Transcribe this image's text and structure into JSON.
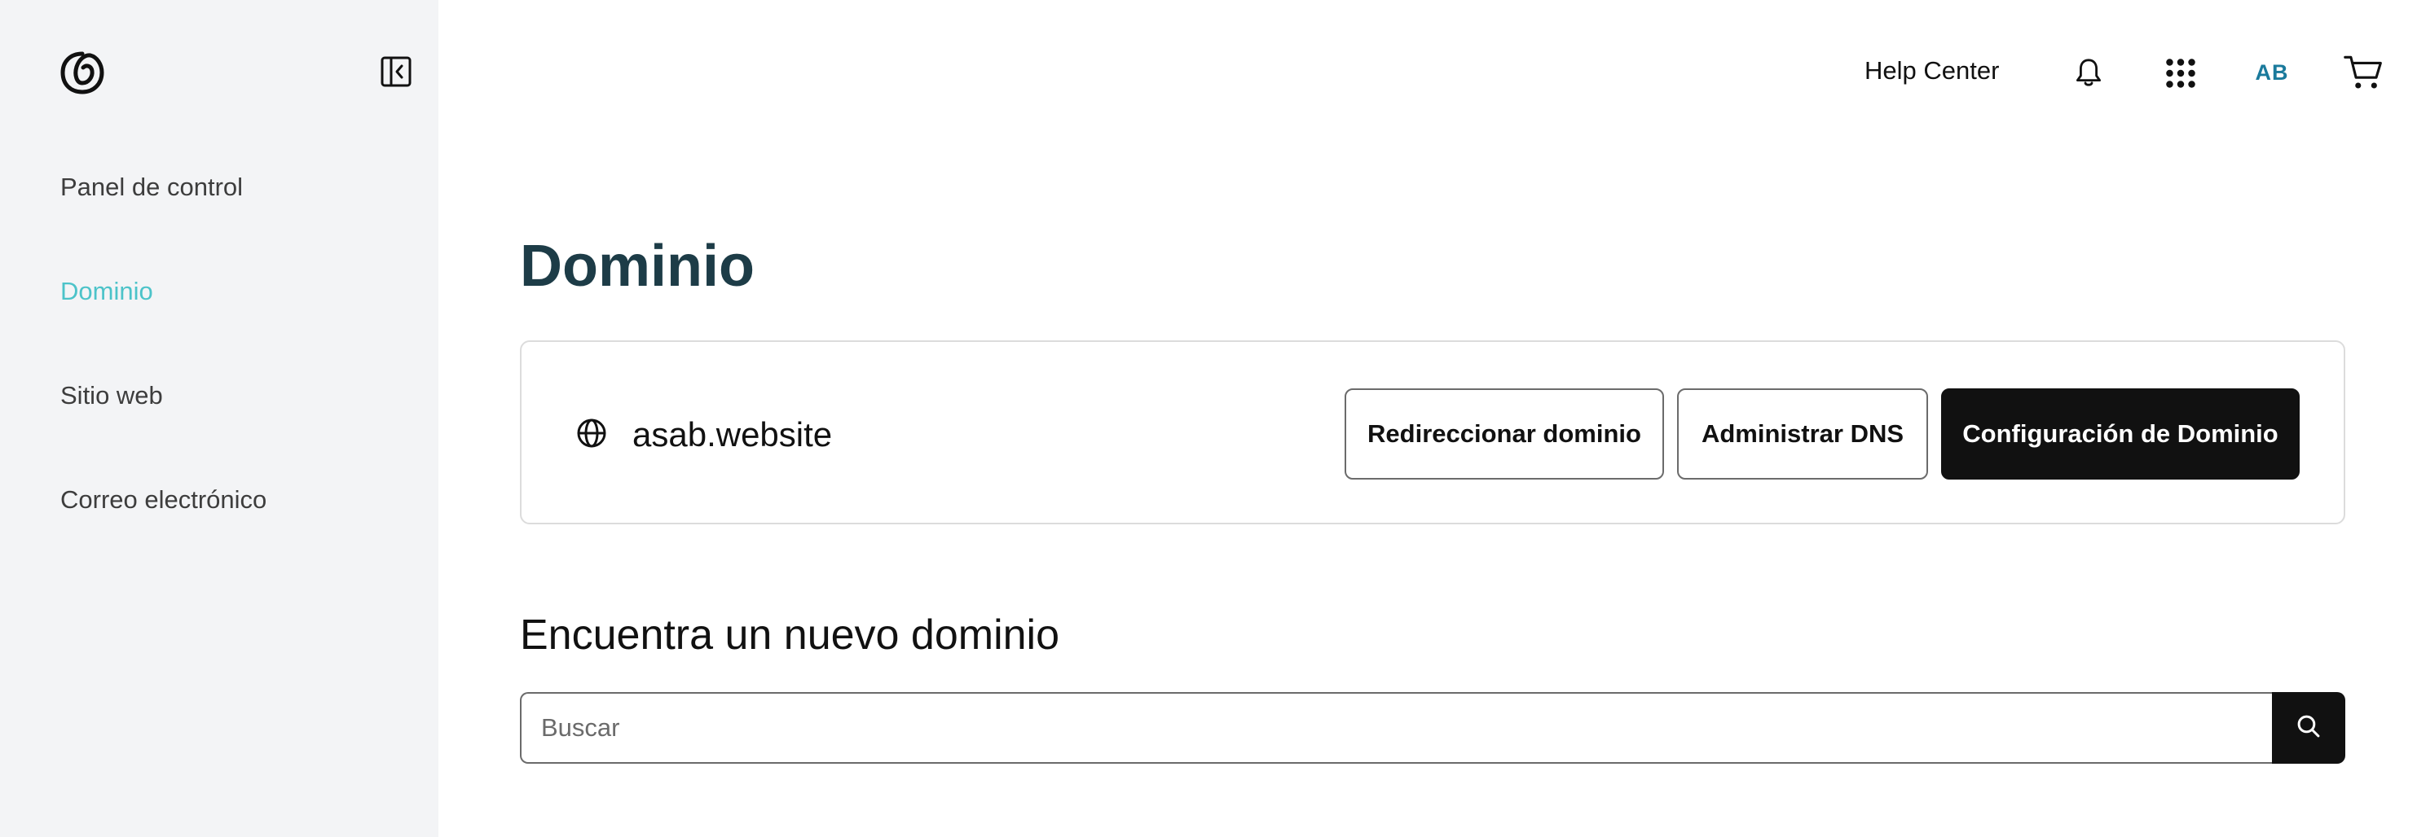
{
  "sidebar": {
    "logo_icon": "godaddy-logo-icon",
    "collapse_icon": "collapse-sidebar-icon",
    "items": [
      {
        "label": "Panel de control",
        "active": false
      },
      {
        "label": "Dominio",
        "active": true
      },
      {
        "label": "Sitio web",
        "active": false
      },
      {
        "label": "Correo electrónico",
        "active": false
      }
    ],
    "active_color": "#4cc3c9"
  },
  "topbar": {
    "help_label": "Help Center",
    "bell_icon": "bell-icon",
    "apps_icon": "apps-grid-icon",
    "avatar_initials": "AB",
    "cart_icon": "cart-icon"
  },
  "main": {
    "title": "Dominio",
    "domain_card": {
      "globe_icon": "globe-icon",
      "domain_name": "asab.website",
      "buttons": {
        "redirect": "Redireccionar dominio",
        "dns": "Administrar DNS",
        "config": "Configuración de Dominio"
      }
    },
    "search_section": {
      "title": "Encuentra un nuevo dominio",
      "placeholder": "Buscar",
      "search_icon": "search-icon"
    }
  },
  "colors": {
    "title": "#1d3c47",
    "primary_button_bg": "#111111",
    "sidebar_bg": "#f3f4f6",
    "avatar_text": "#1a7a9c"
  }
}
